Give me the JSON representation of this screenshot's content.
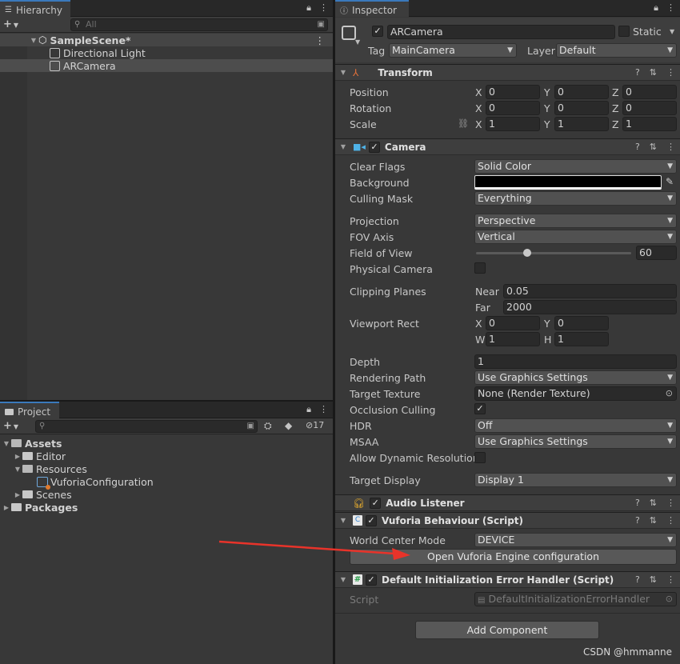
{
  "hierarchy": {
    "tab_label": "Hierarchy",
    "search_placeholder": "All",
    "items": [
      {
        "label": "SampleScene*"
      },
      {
        "label": "Directional Light"
      },
      {
        "label": "ARCamera"
      }
    ]
  },
  "project": {
    "tab_label": "Project",
    "hidden_count": "17",
    "tree": [
      {
        "label": "Assets"
      },
      {
        "label": "Editor"
      },
      {
        "label": "Resources"
      },
      {
        "label": "VuforiaConfiguration"
      },
      {
        "label": "Scenes"
      },
      {
        "label": "Packages"
      }
    ]
  },
  "inspector": {
    "tab_label": "Inspector",
    "object_name": "ARCamera",
    "static_label": "Static",
    "tag_label": "Tag",
    "tag_value": "MainCamera",
    "layer_label": "Layer",
    "layer_value": "Default",
    "transform": {
      "title": "Transform",
      "position": {
        "label": "Position",
        "x": "0",
        "y": "0",
        "z": "0"
      },
      "rotation": {
        "label": "Rotation",
        "x": "0",
        "y": "0",
        "z": "0"
      },
      "scale": {
        "label": "Scale",
        "x": "1",
        "y": "1",
        "z": "1"
      },
      "axis_x": "X",
      "axis_y": "Y",
      "axis_z": "Z"
    },
    "camera": {
      "title": "Camera",
      "clear_flags": {
        "label": "Clear Flags",
        "value": "Solid Color"
      },
      "background": {
        "label": "Background",
        "color": "#000000"
      },
      "culling_mask": {
        "label": "Culling Mask",
        "value": "Everything"
      },
      "projection": {
        "label": "Projection",
        "value": "Perspective"
      },
      "fov_axis": {
        "label": "FOV Axis",
        "value": "Vertical"
      },
      "field_of_view": {
        "label": "Field of View",
        "value": "60",
        "fraction": 0.33
      },
      "physical_camera": {
        "label": "Physical Camera"
      },
      "clipping_planes": {
        "label": "Clipping Planes",
        "near_label": "Near",
        "near": "0.05",
        "far_label": "Far",
        "far": "2000"
      },
      "viewport_rect": {
        "label": "Viewport Rect",
        "x_label": "X",
        "x": "0",
        "y_label": "Y",
        "y": "0",
        "w_label": "W",
        "w": "1",
        "h_label": "H",
        "h": "1"
      },
      "depth": {
        "label": "Depth",
        "value": "1"
      },
      "rendering_path": {
        "label": "Rendering Path",
        "value": "Use Graphics Settings"
      },
      "target_texture": {
        "label": "Target Texture",
        "value": "None (Render Texture)"
      },
      "occlusion_culling": {
        "label": "Occlusion Culling"
      },
      "hdr": {
        "label": "HDR",
        "value": "Off"
      },
      "msaa": {
        "label": "MSAA",
        "value": "Use Graphics Settings"
      },
      "allow_dynamic_resolution": {
        "label": "Allow Dynamic Resolution"
      },
      "target_display": {
        "label": "Target Display",
        "value": "Display 1"
      }
    },
    "audio_listener": {
      "title": "Audio Listener"
    },
    "vuforia": {
      "title": "Vuforia Behaviour (Script)",
      "world_center_mode": {
        "label": "World Center Mode",
        "value": "DEVICE"
      },
      "open_config_button": "Open Vuforia Engine configuration"
    },
    "error_handler": {
      "title": "Default Initialization Error Handler (Script)",
      "script_label": "Script",
      "script_value": "DefaultInitializationErrorHandler"
    },
    "add_component": "Add Component"
  },
  "watermark": "CSDN @hmmanne",
  "colors": {
    "accent": "#3a79bb",
    "arrow": "#e8332a"
  }
}
